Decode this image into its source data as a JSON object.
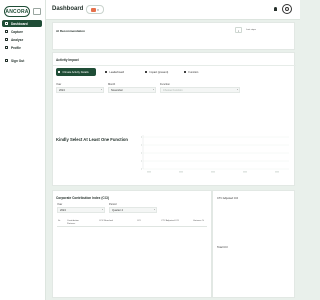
{
  "sidebar": {
    "logo": "ANCORA",
    "items": [
      {
        "label": "Dashboard",
        "icon": "grid-icon",
        "active": true
      },
      {
        "label": "Capture",
        "icon": "capture-icon",
        "active": false
      },
      {
        "label": "Analyse",
        "icon": "chart-icon",
        "active": false
      },
      {
        "label": "Profile",
        "icon": "user-icon",
        "active": false
      },
      {
        "label": "Sign Out",
        "icon": "logout-icon",
        "active": false
      }
    ]
  },
  "header": {
    "title": "Dashboard"
  },
  "recommendation": {
    "title": "AI Recommendation",
    "info": "i",
    "last_steps": "Last steps"
  },
  "activity": {
    "title": "Activity Impact",
    "tabs": [
      {
        "label": "Climate Activity Details",
        "active": true
      },
      {
        "label": "Leaderboard",
        "active": false
      },
      {
        "label": "Impact (present)",
        "active": false
      },
      {
        "label": "Function",
        "active": false
      }
    ],
    "fields": {
      "year_label": "Year",
      "year_value": "2024",
      "month_label": "Month",
      "month_value": "November",
      "function_label": "Function",
      "function_placeholder": "Choose Function"
    },
    "empty_message": "Kindly Select At Least One Function"
  },
  "cci": {
    "title": "Corporate Contribution Index (CCI)",
    "year_label": "Year",
    "year_value": "2024",
    "period_label": "Period",
    "period_value": "Quarter 4",
    "columns": [
      "Sr.",
      "Contribution Partners",
      "CO2 Reached",
      "CCI",
      "CTC Adjusted CCI",
      "Variance %"
    ]
  },
  "panel_right": {
    "ctc_label": "CTC Adjusted CCI",
    "total_label": "Total CCI"
  },
  "colors": {
    "brand": "#1f4d36",
    "background": "#e9f0eb",
    "flag": "#e6704b"
  }
}
